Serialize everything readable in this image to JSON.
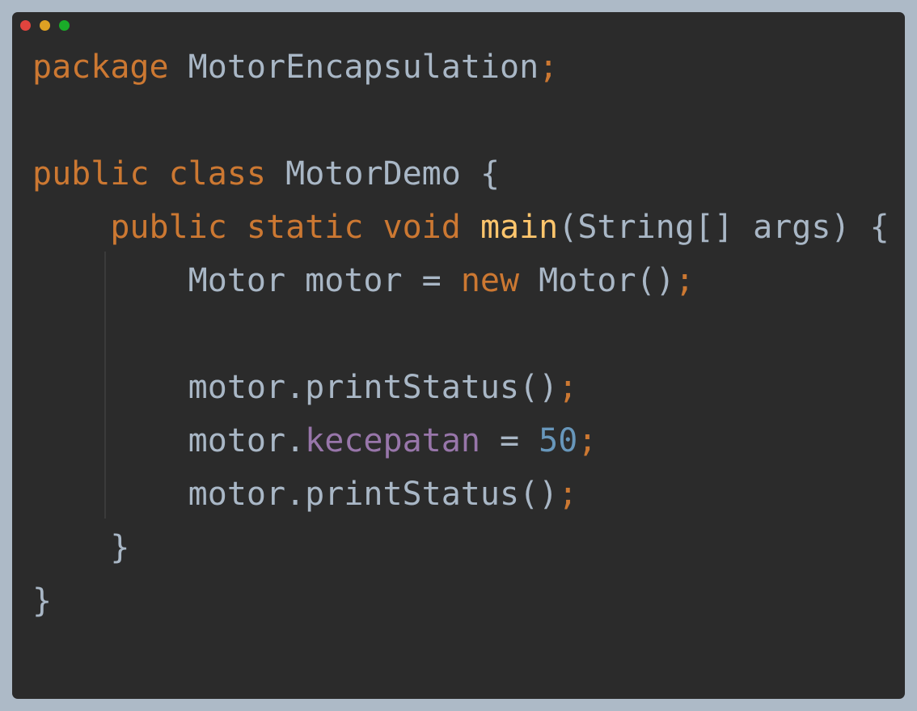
{
  "window": {
    "buttons": [
      {
        "name": "close",
        "color": "#e0443e"
      },
      {
        "name": "minimize",
        "color": "#dea123"
      },
      {
        "name": "zoom",
        "color": "#1aab29"
      }
    ]
  },
  "colors": {
    "background": "#2b2b2b",
    "keyword": "#cc7832",
    "method": "#ffc66d",
    "field": "#9876aa",
    "number": "#6897bb",
    "text": "#a9b7c6"
  },
  "code": {
    "l1": {
      "kw": "package",
      "name": "MotorEncapsulation",
      "semi": ";"
    },
    "l3": {
      "kw1": "public",
      "kw2": "class",
      "name": "MotorDemo",
      "brace": "{"
    },
    "l4": {
      "kw1": "public",
      "kw2": "static",
      "kw3": "void",
      "fn": "main",
      "params": "(String[] args) {"
    },
    "l5": {
      "decl": "Motor motor = ",
      "kw": "new",
      "call": "Motor()",
      "semi": ";"
    },
    "l7": {
      "stmt": "motor.printStatus()",
      "semi": ";"
    },
    "l8": {
      "obj": "motor.",
      "field": "kecepatan",
      "op": " = ",
      "num": "50",
      "semi": ";"
    },
    "l9": {
      "stmt": "motor.printStatus()",
      "semi": ";"
    },
    "l10": {
      "brace": "}"
    },
    "l11": {
      "brace": "}"
    }
  }
}
